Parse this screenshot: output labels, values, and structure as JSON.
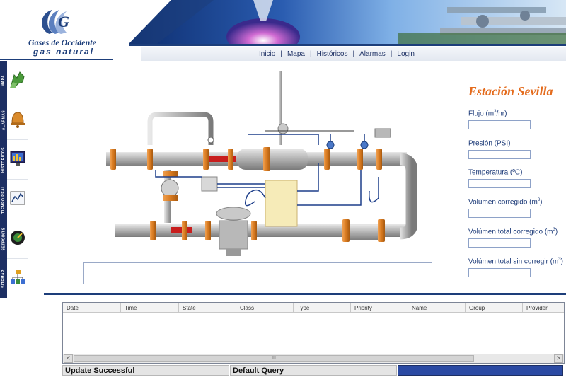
{
  "brand": {
    "name_line1": "Gases de Occidente",
    "name_line2": "gas natural"
  },
  "nav": {
    "items": [
      "Inicio",
      "Mapa",
      "Históricos",
      "Alarmas",
      "Login"
    ],
    "separator": "|"
  },
  "sidebar": {
    "items": [
      {
        "label": "MAPA",
        "icon": "map-icon"
      },
      {
        "label": "ALARMAS",
        "icon": "bell-icon"
      },
      {
        "label": "HISTORICOS",
        "icon": "monitor-icon"
      },
      {
        "label": "TIEMPO REAL",
        "icon": "realtime-chart-icon"
      },
      {
        "label": "SETPOINTS",
        "icon": "gauge-icon"
      },
      {
        "label": "SITEMAP",
        "icon": "sitemap-icon"
      }
    ]
  },
  "station": {
    "title": "Estación Sevilla",
    "fields": [
      {
        "label": "Flujo (m",
        "sup": "3",
        "suffix": "/hr)",
        "value": ""
      },
      {
        "label": "Presión (PSI)",
        "sup": "",
        "suffix": "",
        "value": ""
      },
      {
        "label": "Temperatura (ºC)",
        "sup": "",
        "suffix": "",
        "value": ""
      },
      {
        "label": "Volúmen corregido (m",
        "sup": "3",
        "suffix": ")",
        "value": ""
      },
      {
        "label": "Volúmen total corregido (m",
        "sup": "3",
        "suffix": ")",
        "value": ""
      },
      {
        "label": "Volúmen total sin corregir (m",
        "sup": "3",
        "suffix": ")",
        "value": ""
      }
    ]
  },
  "alarms": {
    "columns": [
      "Date",
      "Time",
      "State",
      "Class",
      "Type",
      "Priority",
      "Name",
      "Group",
      "Provider"
    ],
    "rows": [],
    "scroll": {
      "left": "<",
      "right": ">",
      "grip": "III"
    }
  },
  "status": {
    "message": "Update Successful",
    "query": "Default Query"
  },
  "colors": {
    "brand_blue": "#1d3e7a",
    "accent_orange": "#e46c1e",
    "status_blue": "#2b4aa3"
  }
}
